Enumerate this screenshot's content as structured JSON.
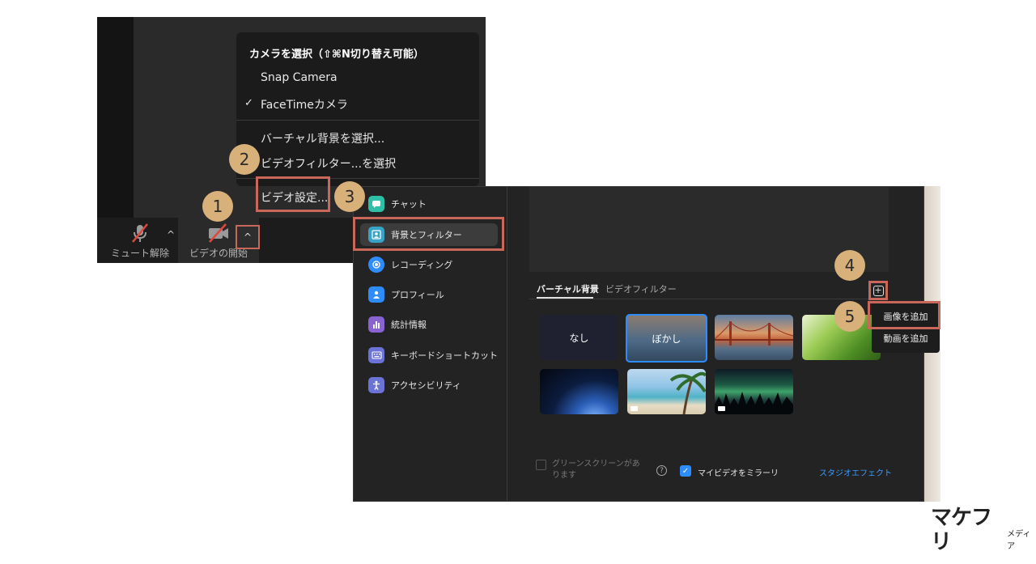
{
  "meeting": {
    "toolbar": {
      "mute_label": "ミュート解除",
      "video_label": "ビデオの開始",
      "caret": "^"
    },
    "camera_menu": {
      "header": "カメラを選択（⇧⌘N切り替え可能）",
      "items": [
        "Snap Camera",
        "FaceTimeカメラ"
      ],
      "selected_mark": "✓",
      "actions": [
        "バーチャル背景を選択...",
        "ビデオフィルター...を選択",
        "ビデオ設定..."
      ]
    }
  },
  "settings": {
    "sidebar": [
      {
        "label": "チャット",
        "icon": "chat-icon",
        "color": "#2fbfa6"
      },
      {
        "label": "背景とフィルター",
        "icon": "person-background-icon",
        "color": "#36a3c7"
      },
      {
        "label": "レコーディング",
        "icon": "record-icon",
        "color": "#2d8cff"
      },
      {
        "label": "プロフィール",
        "icon": "profile-icon",
        "color": "#2d8cff"
      },
      {
        "label": "統計情報",
        "icon": "stats-icon",
        "color": "#8a63d2"
      },
      {
        "label": "キーボードショートカット",
        "icon": "keyboard-icon",
        "color": "#6b74d6"
      },
      {
        "label": "アクセシビリティ",
        "icon": "accessibility-icon",
        "color": "#6b74d6"
      }
    ],
    "tabs": [
      "バーチャル背景",
      "ビデオフィルター"
    ],
    "backgrounds": [
      "なし",
      "ぼかし"
    ],
    "add_menu": [
      "画像を追加",
      "動画を追加"
    ],
    "green_screen_label": "グリーンスクリーンがあります",
    "mirror_label": "マイビデオをミラーリ",
    "studio_link": "スタジオエフェクト"
  },
  "steps": [
    "1",
    "2",
    "3",
    "4",
    "5"
  ],
  "brand": {
    "name": "マケフリ",
    "sub": "メディア"
  },
  "colors": {
    "highlight": "#c9675b",
    "badge": "#d8b07a",
    "accent": "#2d8cff"
  }
}
